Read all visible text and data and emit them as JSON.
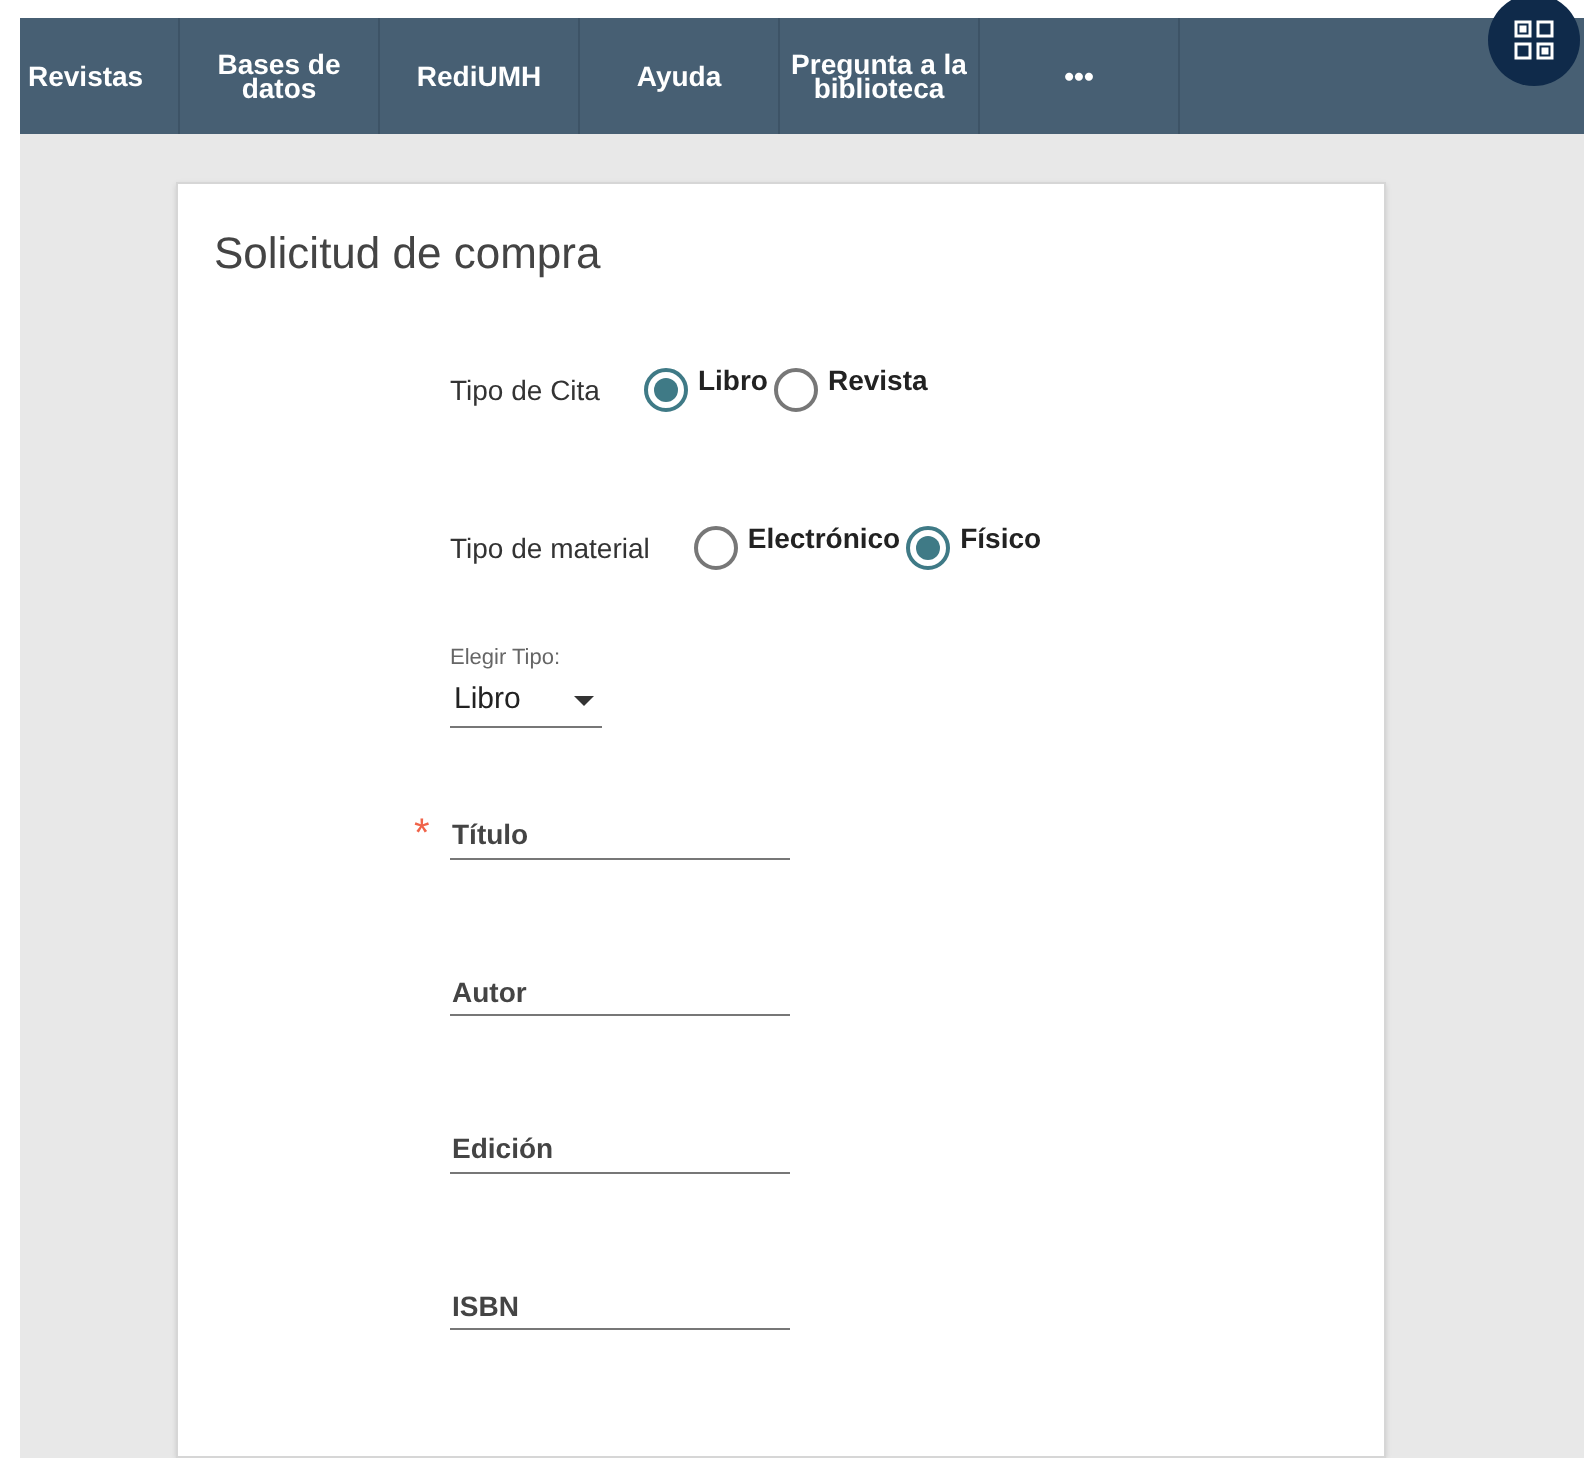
{
  "nav": {
    "items": [
      {
        "label": "Revistas"
      },
      {
        "label": "Bases de datos"
      },
      {
        "label": "RediUMH"
      },
      {
        "label": "Ayuda"
      },
      {
        "label": "Pregunta a la biblioteca"
      },
      {
        "label": "•••"
      }
    ]
  },
  "form": {
    "title": "Solicitud de compra",
    "radio_groups": [
      {
        "label": "Tipo de Cita",
        "options": [
          {
            "label": "Libro",
            "selected": true
          },
          {
            "label": "Revista",
            "selected": false
          }
        ]
      },
      {
        "label": "Tipo de material",
        "options": [
          {
            "label": "Electrónico",
            "selected": false
          },
          {
            "label": "Físico",
            "selected": true
          }
        ]
      }
    ],
    "select": {
      "label": "Elegir Tipo:",
      "value": "Libro"
    },
    "fields": [
      {
        "placeholder": "Título",
        "required_mark": "*"
      },
      {
        "placeholder": "Autor"
      },
      {
        "placeholder": "Edición"
      },
      {
        "placeholder": "ISBN"
      }
    ]
  }
}
